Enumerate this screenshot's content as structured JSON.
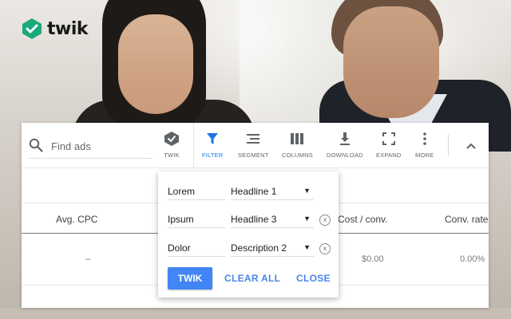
{
  "brand": {
    "name": "twik",
    "accent": "#1aa97a"
  },
  "search": {
    "placeholder": "Find ads",
    "icon": "search-icon"
  },
  "toolbar": {
    "items": [
      {
        "label": "TWIK",
        "icon": "twik-logo-icon"
      },
      {
        "label": "FILTER",
        "icon": "filter-icon",
        "active": true
      },
      {
        "label": "SEGMENT",
        "icon": "segment-icon"
      },
      {
        "label": "COLUMNS",
        "icon": "columns-icon"
      },
      {
        "label": "DOWNLOAD",
        "icon": "download-icon"
      },
      {
        "label": "EXPAND",
        "icon": "expand-icon"
      },
      {
        "label": "MORE",
        "icon": "more-vert-icon"
      }
    ],
    "collapse_icon": "chevron-up-icon",
    "active_color": "#1a73e8"
  },
  "table": {
    "headers": [
      "Avg. CPC",
      "Cost / conv.",
      "Conv. rate"
    ],
    "row": [
      "–",
      "$0.00",
      "0.00%"
    ]
  },
  "filter_popup": {
    "rows": [
      {
        "name": "Lorem",
        "value": "Headline 1",
        "clearable": false
      },
      {
        "name": "Ipsum",
        "value": "Headline 3",
        "clearable": true
      },
      {
        "name": "Dolor",
        "value": "Description 2",
        "clearable": true
      }
    ],
    "dropdown_arrow": "▼",
    "clear_glyph": "x",
    "buttons": {
      "apply": "TWIK",
      "clear": "CLEAR ALL",
      "close": "CLOSE"
    },
    "button_color": "#4285f4"
  }
}
